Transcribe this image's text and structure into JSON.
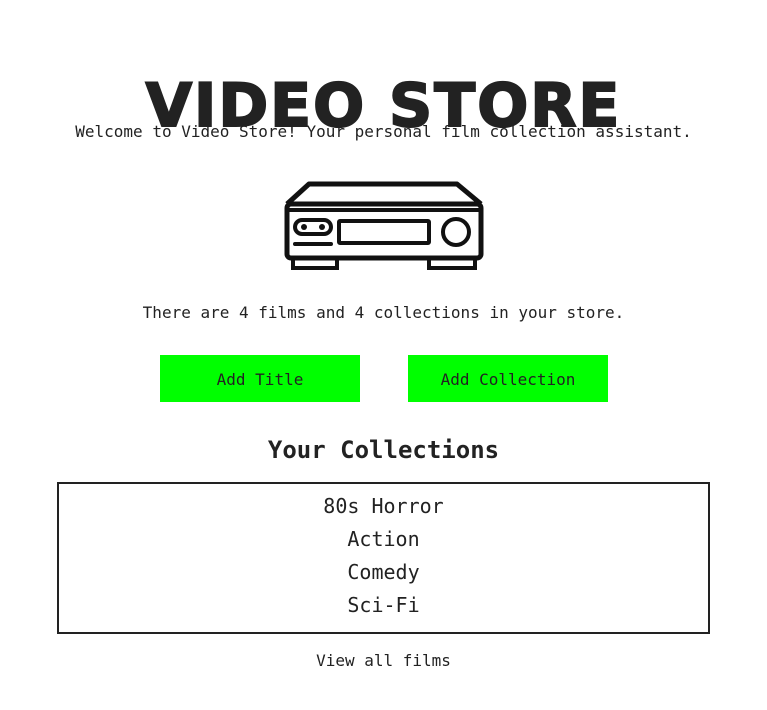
{
  "header": {
    "title": "VIDEO STORE",
    "welcome": "Welcome to Video Store! Your personal film collection assistant."
  },
  "hero": {
    "icon": "vcr-icon"
  },
  "summary": {
    "text": "There are 4 films and 4 collections in your store."
  },
  "actions": {
    "add_title_label": "Add Title",
    "add_collection_label": "Add Collection"
  },
  "collections": {
    "heading": "Your Collections",
    "items": [
      {
        "label": "80s Horror"
      },
      {
        "label": "Action"
      },
      {
        "label": "Comedy"
      },
      {
        "label": "Sci-Fi"
      }
    ]
  },
  "footer": {
    "view_all_label": "View all films"
  },
  "colors": {
    "button_background": "#00ff00",
    "text": "#222222",
    "background": "#ffffff"
  }
}
